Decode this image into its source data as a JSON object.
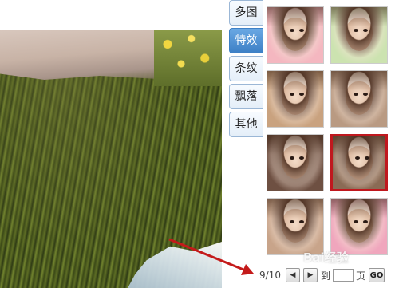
{
  "tabs": [
    {
      "label": "多图",
      "active": false
    },
    {
      "label": "特效",
      "active": true
    },
    {
      "label": "条纹",
      "active": false
    },
    {
      "label": "飘落",
      "active": false
    },
    {
      "label": "其他",
      "active": false
    }
  ],
  "thumbnails": [
    {
      "tint": "#f4b7c0",
      "selected": false
    },
    {
      "tint": "#cce3b0",
      "selected": false
    },
    {
      "tint": "#c9a27f",
      "selected": false
    },
    {
      "tint": "#b99a82",
      "selected": false
    },
    {
      "tint": "#6e5042",
      "selected": false
    },
    {
      "tint": "#8a6b55",
      "selected": true
    },
    {
      "tint": "#c8a48a",
      "selected": false
    },
    {
      "tint": "#f0a6bd",
      "selected": false
    }
  ],
  "pager": {
    "count": "9/10",
    "prev_icon": "triangle-left-icon",
    "next_icon": "triangle-right-icon",
    "goto_prefix": "到",
    "goto_suffix": "页",
    "page_input_value": "",
    "go_label": "GO"
  },
  "watermark": "Bai经验",
  "colors": {
    "accent": "#3d80c6",
    "selection": "#c0181e",
    "arrow": "#c41a1a"
  }
}
